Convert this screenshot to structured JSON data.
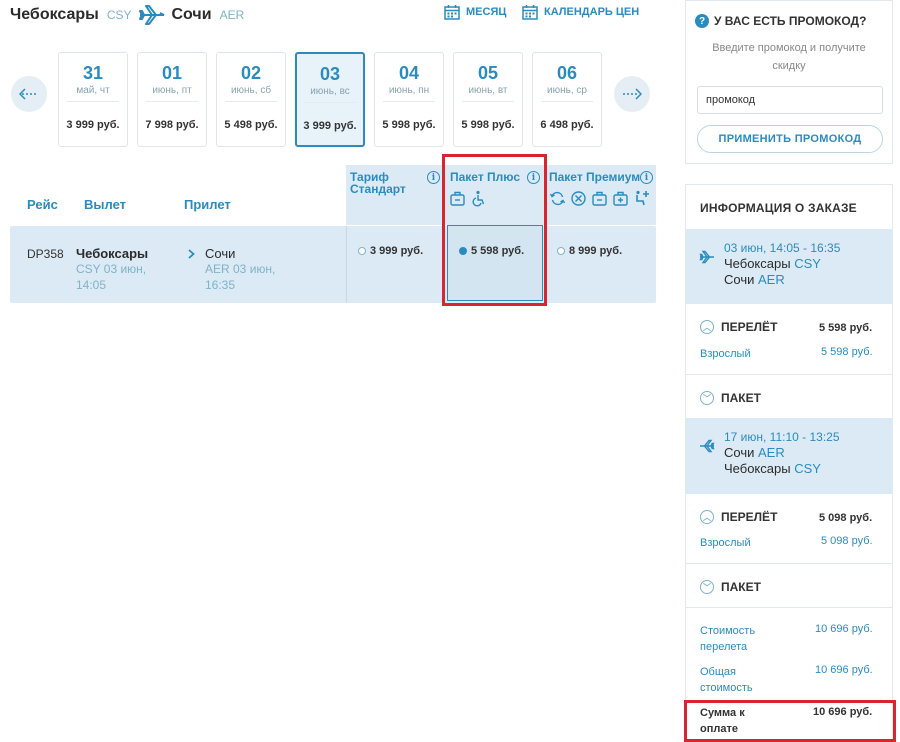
{
  "header": {
    "from_city": "Чебоксары",
    "from_code": "CSY",
    "to_city": "Сочи",
    "to_code": "AER",
    "month_link": "МЕСЯЦ",
    "calendar_link": "КАЛЕНДАРЬ ЦЕН"
  },
  "dates": [
    {
      "num": "31",
      "weekday": "май, чт",
      "price": "3 999 руб."
    },
    {
      "num": "01",
      "weekday": "июнь, пт",
      "price": "7 998 руб."
    },
    {
      "num": "02",
      "weekday": "июнь, сб",
      "price": "5 498 руб."
    },
    {
      "num": "03",
      "weekday": "июнь, вс",
      "price": "3 999 руб."
    },
    {
      "num": "04",
      "weekday": "июнь, пн",
      "price": "5 998 руб."
    },
    {
      "num": "05",
      "weekday": "июнь, вт",
      "price": "5 998 руб."
    },
    {
      "num": "06",
      "weekday": "июнь, ср",
      "price": "6 498 руб."
    }
  ],
  "table": {
    "col_flight": "Рейс",
    "col_departure": "Вылет",
    "col_arrival": "Прилет",
    "tariff_standard_l1": "Тариф",
    "tariff_standard_l2": "Стандарт",
    "tariff_plus": "Пакет Плюс",
    "tariff_premium": "Пакет Премиум",
    "row": {
      "flight": "DP358",
      "dep_city": "Чебоксары",
      "dep_l1": "CSY 03 июн,",
      "dep_l2": "14:05",
      "arr_city": "Сочи",
      "arr_l1": "AER 03 июн,",
      "arr_l2": "16:35",
      "price_standard": "3 999 руб.",
      "price_plus": "5 598 руб.",
      "price_premium": "8 999 руб."
    }
  },
  "promo": {
    "title": "У ВАС ЕСТЬ ПРОМОКОД?",
    "desc_l1": "Введите промокод и получите",
    "desc_l2": "скидку",
    "input_value": "промокод",
    "apply_label": "ПРИМЕНИТЬ ПРОМОКОД"
  },
  "order": {
    "title": "ИНФОРМАЦИЯ О ЗАКАЗЕ",
    "seg1": {
      "datetime": "03 июн, 14:05 - 16:35",
      "from": "Чебоксары",
      "from_code": "CSY",
      "to": "Сочи",
      "to_code": "AER"
    },
    "flight1_label": "ПЕРЕЛЁТ",
    "flight1_amount": "5 598 руб.",
    "adult1_label": "Взрослый",
    "adult1_amount": "5 598 руб.",
    "package1_label": "ПАКЕТ",
    "seg2": {
      "datetime": "17 июн, 11:10 - 13:25",
      "from": "Сочи",
      "from_code": "AER",
      "to": "Чебоксары",
      "to_code": "CSY"
    },
    "flight2_label": "ПЕРЕЛЁТ",
    "flight2_amount": "5 098 руб.",
    "adult2_label": "Взрослый",
    "adult2_amount": "5 098 руб.",
    "package2_label": "ПАКЕТ",
    "cost_flight_l1": "Стоимость",
    "cost_flight_l2": "перелета",
    "cost_flight_amount": "10 696 руб.",
    "total_l1": "Общая",
    "total_l2": "стоимость",
    "total_amount": "10 696 руб.",
    "pay_l1": "Сумма к",
    "pay_l2": "оплате",
    "pay_amount": "10 696 руб."
  },
  "colors": {
    "accent": "#2b8bbf",
    "highlight": "#d9252f",
    "row_bg": "#dbeaf4"
  }
}
